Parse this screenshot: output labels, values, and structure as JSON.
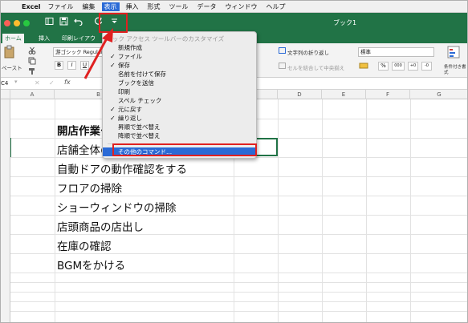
{
  "menubar": {
    "app": "Excel",
    "items": [
      "ファイル",
      "編集",
      "表示",
      "挿入",
      "形式",
      "ツール",
      "データ",
      "ウィンドウ",
      "ヘルプ"
    ],
    "active_index": 2
  },
  "window": {
    "title": "ブック1"
  },
  "tabs": [
    "ホーム",
    "挿入",
    "印刷レイアウ"
  ],
  "ribbon": {
    "paste_label": "ペースト",
    "font_name": "游ゴシック Regular",
    "bold": "B",
    "italic": "I",
    "underline": "U",
    "wrap_text": "文字列の折り返し",
    "merge_center": "セルを結合して中央揃え",
    "number_format": "標準",
    "percent": "%",
    "comma": "000",
    "conditional": "条件付き書式"
  },
  "formula_bar": {
    "name_box": "C4",
    "fx": "fx"
  },
  "columns": [
    "A",
    "B",
    "C",
    "D",
    "E",
    "F",
    "G"
  ],
  "rows": [
    "1",
    "2",
    "3",
    "4",
    "5",
    "6",
    "7",
    "8",
    "9",
    "10",
    "11",
    "12",
    "13",
    "14",
    "15"
  ],
  "cells": {
    "title": "開店作業チ",
    "item1": "店舗全体の",
    "item2": "自動ドアの動作確認をする",
    "item3": "フロアの掃除",
    "item4": "ショーウィンドウの掃除",
    "item5": "店頭商品の店出し",
    "item6": "在庫の確認",
    "item7": "BGMをかける"
  },
  "dropdown": {
    "header": "ック アクセス ツールバーのカスタマイズ",
    "items": [
      {
        "label": "新規作成",
        "checked": false
      },
      {
        "label": "ファイル",
        "checked": true
      },
      {
        "label": "保存",
        "checked": true
      },
      {
        "label": "名前を付けて保存",
        "checked": false
      },
      {
        "label": "ブックを送信",
        "checked": false
      },
      {
        "label": "印刷",
        "checked": false
      },
      {
        "label": "スペル チェック",
        "checked": false
      },
      {
        "label": "元に戻す",
        "checked": true
      },
      {
        "label": "繰り返し",
        "checked": true
      },
      {
        "label": "昇順で並べ替え",
        "checked": false
      },
      {
        "label": "降順で並べ替え",
        "checked": false
      }
    ],
    "more_commands": "その他のコマンド..."
  },
  "icons": {
    "apple": "apple-icon",
    "customize": "dropdown-arrow-icon",
    "checkmark": "checkmark-icon"
  },
  "colors": {
    "accent": "#217346",
    "highlight": "#2a6ad6",
    "annotation": "#e02020"
  }
}
